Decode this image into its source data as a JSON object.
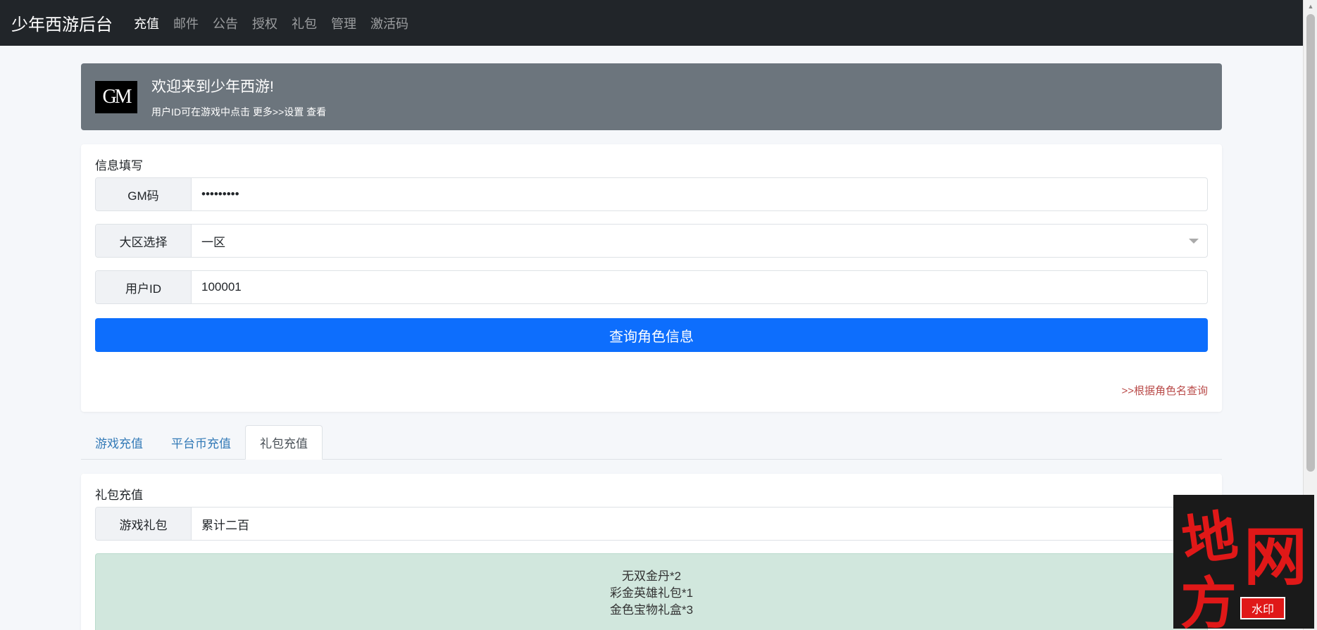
{
  "navbar": {
    "brand": "少年西游后台",
    "items": [
      "充值",
      "邮件",
      "公告",
      "授权",
      "礼包",
      "管理",
      "激活码"
    ]
  },
  "welcome": {
    "logo": "GM",
    "title": "欢迎来到少年西游!",
    "subtitle": "用户ID可在游戏中点击 更多>>设置 查看"
  },
  "info_form": {
    "title": "信息填写",
    "gm_code": {
      "label": "GM码",
      "value": "•••••••••"
    },
    "region": {
      "label": "大区选择",
      "value": "一区"
    },
    "user_id": {
      "label": "用户ID",
      "value": "100001"
    },
    "query_button": "查询角色信息",
    "role_link": ">>根据角色名查询"
  },
  "tabs": [
    "游戏充值",
    "平台币充值",
    "礼包充值"
  ],
  "gift": {
    "title": "礼包充值",
    "package": {
      "label": "游戏礼包",
      "value": "累计二百"
    },
    "contents": [
      "无双金丹*2",
      "彩金英雄礼包*1",
      "金色宝物礼盒*3"
    ]
  },
  "watermark": {
    "chars": [
      "地",
      "网",
      "方"
    ],
    "badge": "水印"
  }
}
